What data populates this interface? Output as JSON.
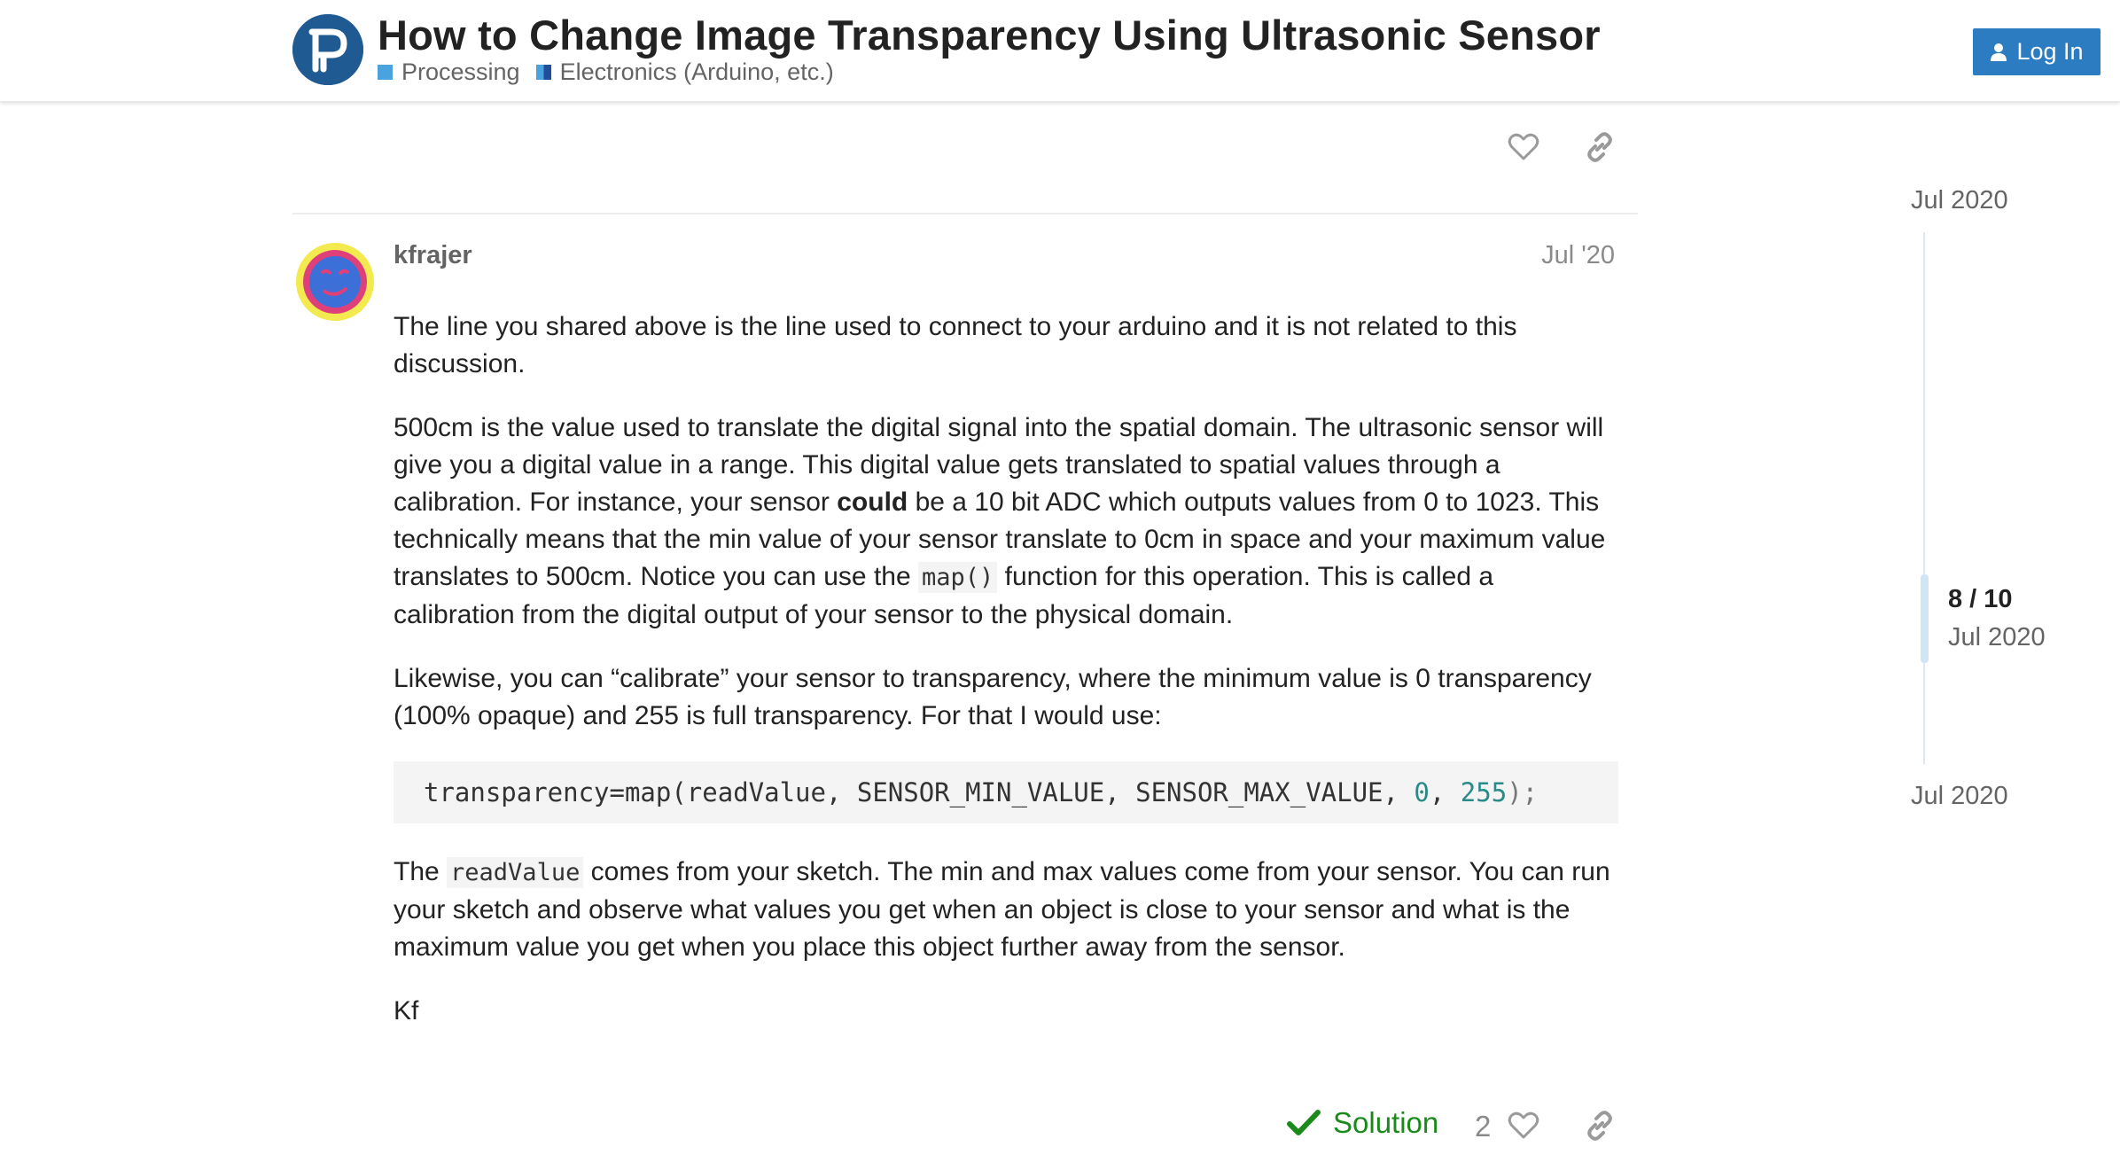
{
  "header": {
    "title": "How to Change Image Transparency Using Ultrasonic Sensor",
    "categories": [
      {
        "label": "Processing",
        "color": "#4aa3df"
      },
      {
        "label": "Electronics (Arduino, etc.)",
        "color": "#1f4e9a"
      }
    ],
    "login_label": "Log In"
  },
  "post": {
    "username": "kfrajer",
    "date": "Jul '20",
    "paragraphs": {
      "p1": "The line you shared above is the line used to connect to your arduino and it is not related to this discussion.",
      "p2_a": "500cm is the value used to translate the digital signal into the spatial domain. The ultrasonic sensor will give you a digital value in a range. This digital value gets translated to spatial values through a calibration. For instance, your sensor ",
      "p2_bold": "could",
      "p2_b": " be a 10 bit ADC which outputs values from 0 to 1023. This technically means that the min value of your sensor translate to 0cm in space and your maximum value translates to 500cm. Notice you can use the ",
      "p2_code": "map()",
      "p2_c": " function for this operation. This is called a calibration from the digital output of your sensor to the physical domain.",
      "p3": "Likewise, you can “calibrate” your sensor to transparency, where the minimum value is 0 transparency (100% opaque) and 255 is full transparency. For that I would use:",
      "code_main": "transparency=map(readValue, SENSOR_MIN_VALUE, SENSOR_MAX_VALUE, ",
      "code_num1": "0",
      "code_sep": ", ",
      "code_num2": "255",
      "code_end": ");",
      "p4_a": "The ",
      "p4_code": "readValue",
      "p4_b": " comes from your sketch. The min and max values come from your sensor. You can run your sketch and observe what values you get when an object is close to your sensor and what is the maximum value you get when you place this object further away from the sensor.",
      "signature": "Kf"
    },
    "solution_label": "Solution",
    "like_count": "2"
  },
  "timeline": {
    "top_date": "Jul 2020",
    "position": "8 / 10",
    "position_date": "Jul 2020",
    "bottom_date": "Jul 2020"
  },
  "icons": [
    "processing-logo",
    "user-icon",
    "heart-icon",
    "link-icon",
    "check-icon",
    "avatar"
  ]
}
